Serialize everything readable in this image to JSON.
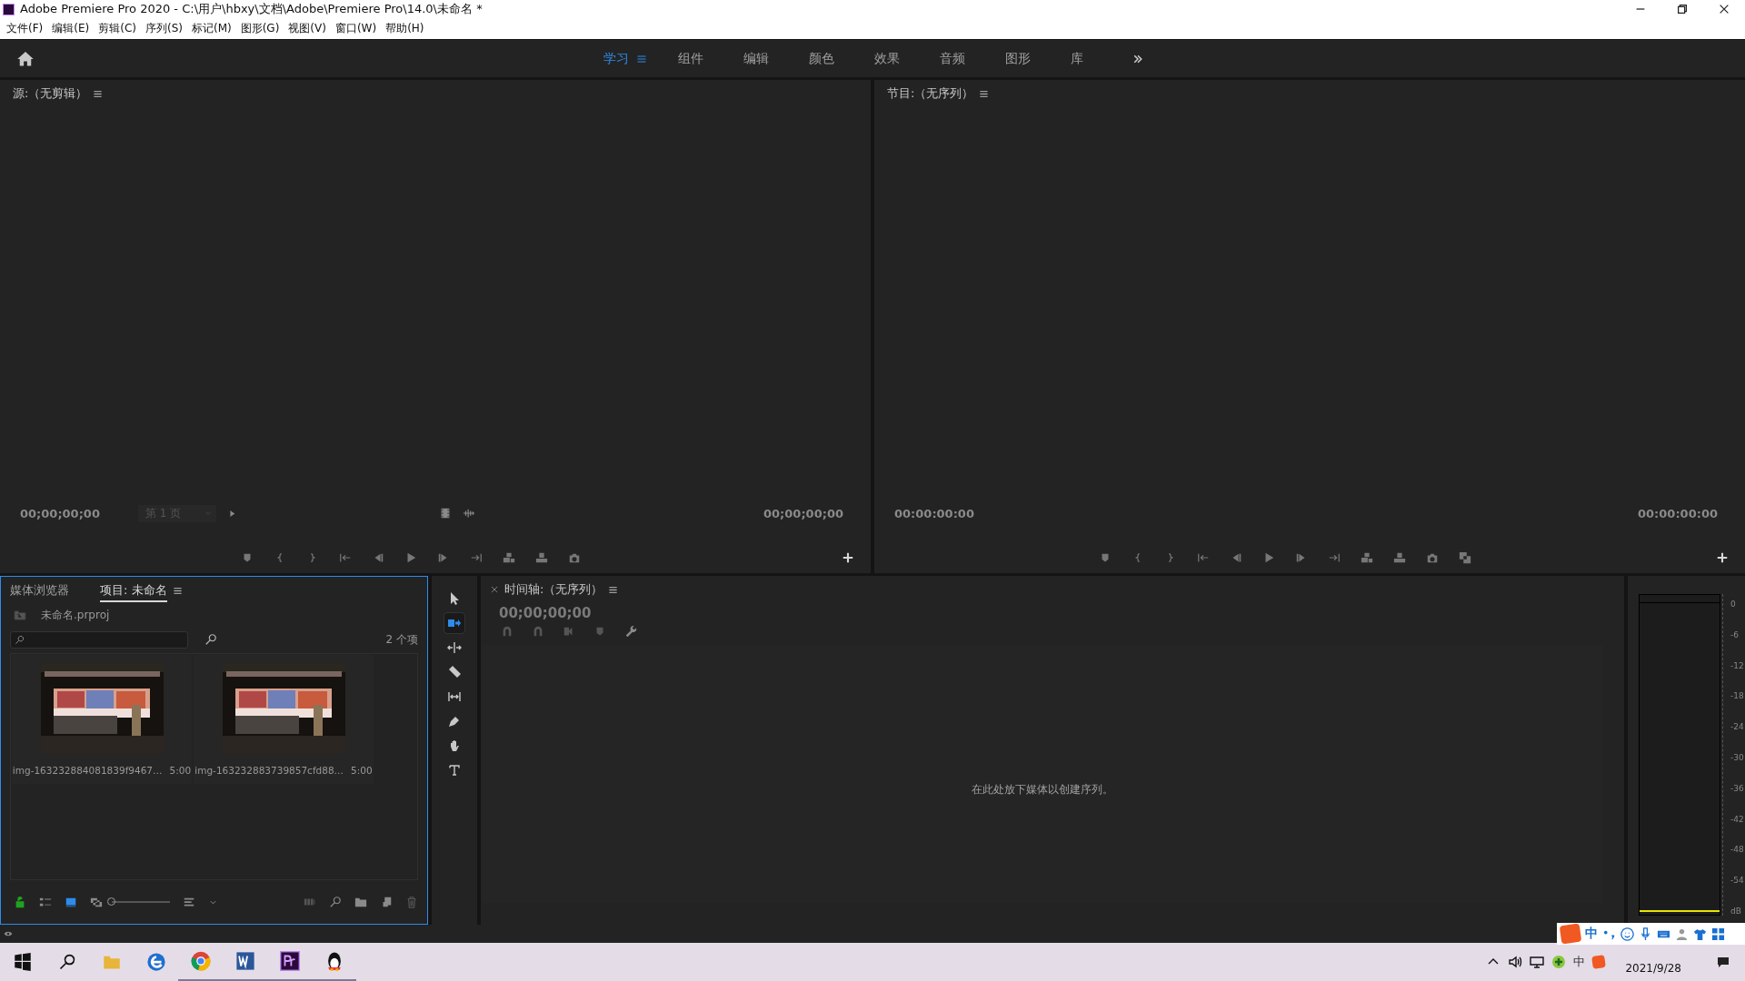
{
  "window": {
    "title": "Adobe Premiere Pro 2020 - C:\\用户\\hbxy\\文档\\Adobe\\Premiere Pro\\14.0\\未命名 *"
  },
  "menu": [
    "文件(F)",
    "编辑(E)",
    "剪辑(C)",
    "序列(S)",
    "标记(M)",
    "图形(G)",
    "视图(V)",
    "窗口(W)",
    "帮助(H)"
  ],
  "workspaces": [
    {
      "label": "学习",
      "selected": true
    },
    {
      "label": "组件",
      "selected": false
    },
    {
      "label": "编辑",
      "selected": false
    },
    {
      "label": "颜色",
      "selected": false
    },
    {
      "label": "效果",
      "selected": false
    },
    {
      "label": "音频",
      "selected": false
    },
    {
      "label": "图形",
      "selected": false
    },
    {
      "label": "库",
      "selected": false
    }
  ],
  "source_monitor": {
    "title": "源:（无剪辑）",
    "timecode_in": "00;00;00;00",
    "page_select": "第 1 页",
    "timecode_out": "00;00;00;00"
  },
  "program_monitor": {
    "title": "节目:（无序列）",
    "timecode_in": "00:00:00:00",
    "timecode_out": "00:00:00:00"
  },
  "project_panel": {
    "tabs": [
      {
        "label": "媒体浏览器",
        "selected": false
      },
      {
        "label": "项目: 未命名",
        "selected": true
      }
    ],
    "project_file": "未命名.prproj",
    "item_count": "2 个项",
    "zoom": {
      "level": 0
    },
    "items": [
      {
        "name": "img-163232884081839f9467…",
        "duration": "5:00"
      },
      {
        "name": "img-163232883739857cfd88…",
        "duration": "5:00"
      }
    ]
  },
  "tools": [
    {
      "kind": "selection",
      "selected": false
    },
    {
      "kind": "track-select",
      "selected": true
    },
    {
      "kind": "ripple",
      "selected": false
    },
    {
      "kind": "razor",
      "selected": false
    },
    {
      "kind": "slip",
      "selected": false
    },
    {
      "kind": "pen",
      "selected": false
    },
    {
      "kind": "hand",
      "selected": false
    },
    {
      "kind": "type",
      "selected": false
    }
  ],
  "timeline": {
    "title": "时间轴:（无序列）",
    "timecode": "00;00;00;00",
    "empty_hint": "在此处放下媒体以创建序列。"
  },
  "audio_meter": {
    "scale": [
      "0",
      "-6",
      "-12",
      "-18",
      "-24",
      "-30",
      "-36",
      "-42",
      "-48",
      "-54",
      "dB"
    ]
  },
  "ime_bar": {
    "mode": "中"
  },
  "taskbar": {
    "apps": [
      {
        "kind": "start",
        "running": false
      },
      {
        "kind": "search",
        "running": false
      },
      {
        "kind": "folder",
        "running": false
      },
      {
        "kind": "edge",
        "running": false
      },
      {
        "kind": "chrome",
        "running": true
      },
      {
        "kind": "word",
        "running": true
      },
      {
        "kind": "premiere",
        "running": true
      },
      {
        "kind": "penguin",
        "running": true
      }
    ],
    "tray_ime": "中",
    "date": "2021/9/28"
  }
}
